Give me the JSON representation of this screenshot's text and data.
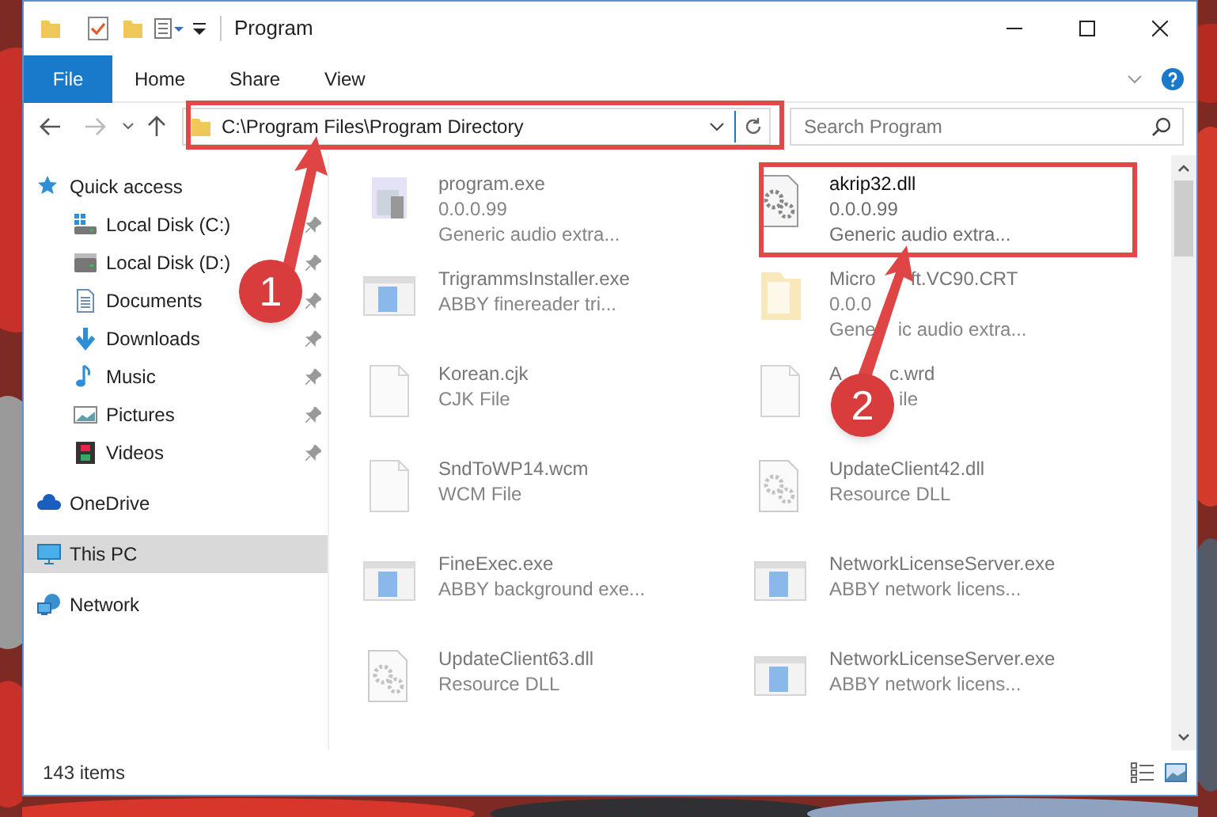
{
  "window": {
    "title": "Program"
  },
  "ribbon": {
    "file_tab": "File",
    "tabs": [
      "Home",
      "Share",
      "View"
    ]
  },
  "address": {
    "path": "C:\\Program Files\\Program Directory"
  },
  "search": {
    "placeholder": "Search Program"
  },
  "sidebar": {
    "items": [
      {
        "label": "Quick access",
        "selected": false,
        "children": [
          {
            "label": "Local Disk (C:)",
            "pinned": true
          },
          {
            "label": "Local Disk (D:)",
            "pinned": true
          },
          {
            "label": "Documents",
            "pinned": true
          },
          {
            "label": "Downloads",
            "pinned": true
          },
          {
            "label": "Music",
            "pinned": true
          },
          {
            "label": "Pictures",
            "pinned": true
          },
          {
            "label": "Videos",
            "pinned": true
          }
        ]
      },
      {
        "label": "OneDrive",
        "selected": false
      },
      {
        "label": "This PC",
        "selected": true
      },
      {
        "label": "Network",
        "selected": false
      }
    ]
  },
  "files": [
    {
      "kind": "program",
      "name": [
        "program.exe"
      ],
      "version": [
        "0.0.0.99"
      ],
      "description": [
        "Generic audio extra..."
      ],
      "blurred": true
    },
    {
      "kind": "dll",
      "name": [
        "akrip32.dll"
      ],
      "version": [
        "0.0.0.99"
      ],
      "description": [
        "Generic audio extra..."
      ],
      "blurred": false
    },
    {
      "kind": "app",
      "name": [
        "TrigrammsInstaller.exe"
      ],
      "description": [
        "ABBY finereader tri..."
      ],
      "blurred": true
    },
    {
      "kind": "folder",
      "name": [
        "Micro",
        "ft.VC90.CRT"
      ],
      "version": [
        "0.0.0"
      ],
      "description": [
        "Gene",
        "ic audio extra..."
      ],
      "blurred": true
    },
    {
      "kind": "document",
      "name": [
        "Korean.cjk"
      ],
      "description": [
        "CJK File"
      ],
      "blurred": true
    },
    {
      "kind": "document",
      "name": [
        "A",
        "c.wrd"
      ],
      "description": [
        "ile"
      ],
      "blurred": true
    },
    {
      "kind": "document",
      "name": [
        "SndToWP14.wcm"
      ],
      "description": [
        "WCM File"
      ],
      "blurred": true
    },
    {
      "kind": "dll",
      "name": [
        "UpdateClient42.dll"
      ],
      "description": [
        "Resource DLL"
      ],
      "blurred": true
    },
    {
      "kind": "app",
      "name": [
        "FineExec.exe"
      ],
      "description": [
        "ABBY background exe..."
      ],
      "blurred": true
    },
    {
      "kind": "app",
      "name": [
        "NetworkLicenseServer.exe"
      ],
      "description": [
        "ABBY network licens..."
      ],
      "blurred": true
    },
    {
      "kind": "dll",
      "name": [
        "UpdateClient63.dll"
      ],
      "description": [
        "Resource DLL"
      ],
      "blurred": true
    },
    {
      "kind": "app",
      "name": [
        "NetworkLicenseServer.exe"
      ],
      "description": [
        "ABBY network licens..."
      ],
      "blurred": true
    }
  ],
  "status_bar": {
    "count": "143 items"
  },
  "annotations": [
    {
      "label": "1"
    },
    {
      "label": "2"
    }
  ]
}
